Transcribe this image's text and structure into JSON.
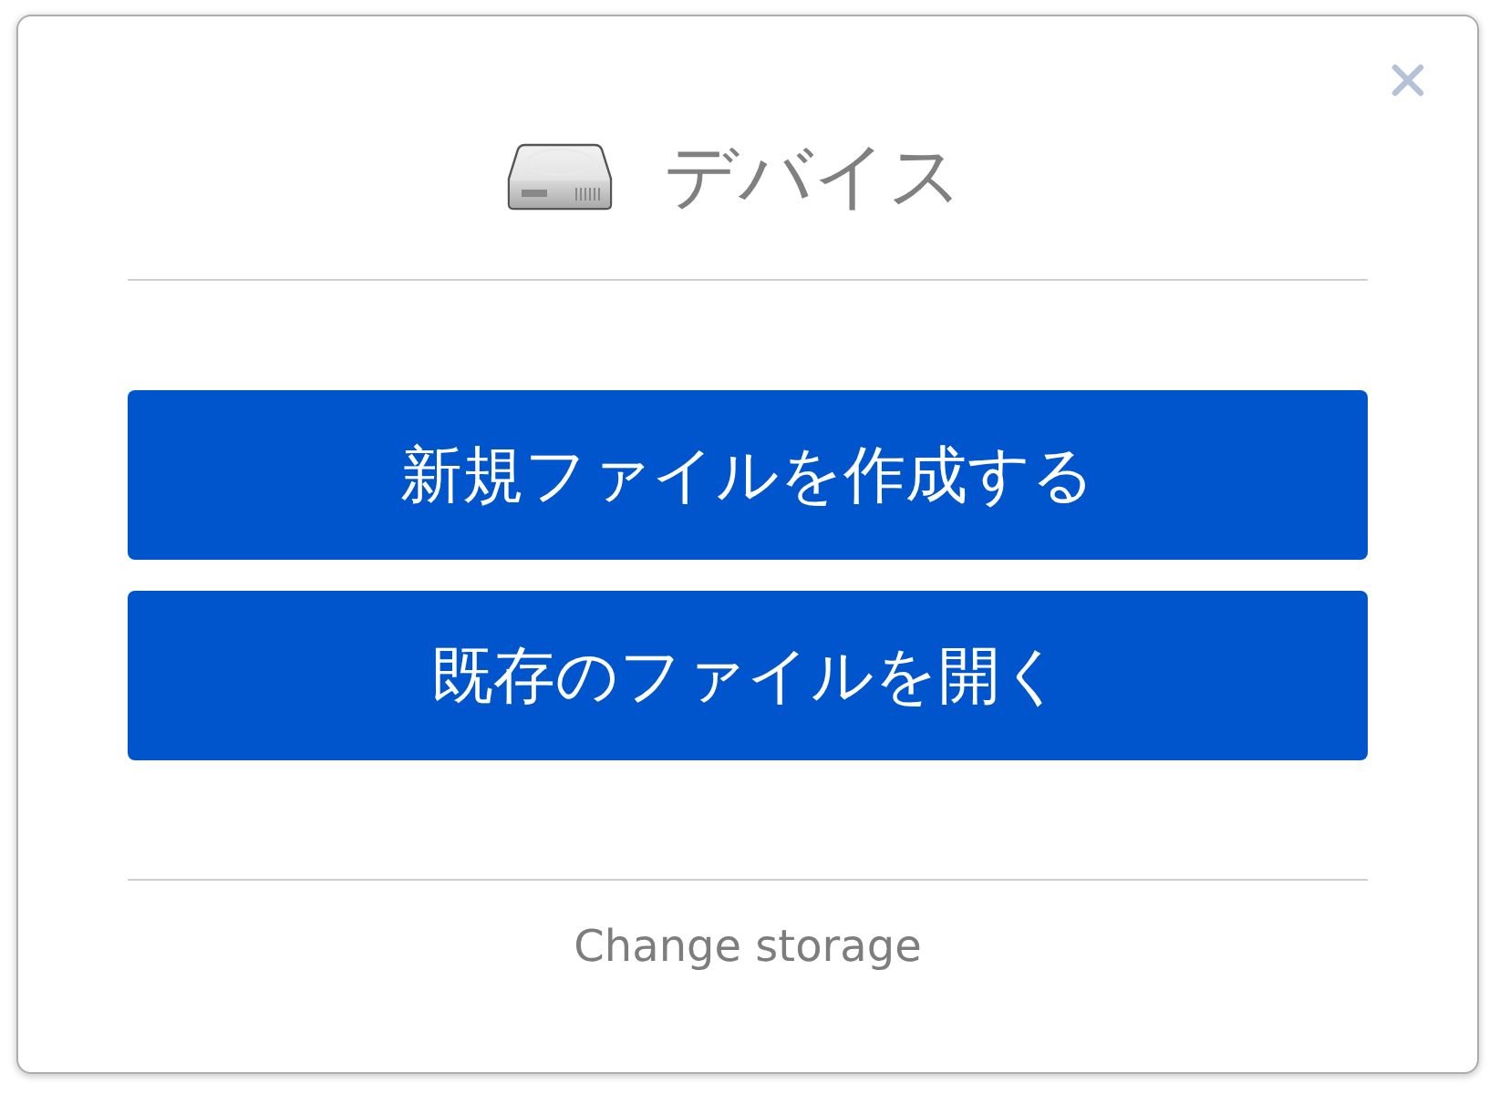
{
  "title": "デバイス",
  "actions": [
    {
      "label": "新規ファイルを作成する"
    },
    {
      "label": "既存のファイルを開く"
    }
  ],
  "footer_link": "Change storage"
}
